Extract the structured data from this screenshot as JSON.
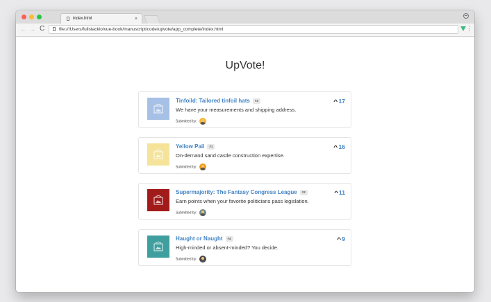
{
  "browser": {
    "tab_title": "index.html",
    "tab_close": "×",
    "url": "file:///Users/fullstackio/vue-book/manuscript/code/upvote/app_complete/index.html",
    "nav_back": "←",
    "nav_forward": "→",
    "nav_reload": "C",
    "menu": "⋮"
  },
  "app": {
    "title": "UpVote!"
  },
  "submissions": [
    {
      "title": "Tinfoild: Tailored tinfoil hats",
      "badge": "#3",
      "description": "We have your measurements and shipping address.",
      "submitted_by": "Submitted by:",
      "votes": "17",
      "thumb_color": "#a6c0e6",
      "avatar_color": "#f7b731"
    },
    {
      "title": "Yellow Pail",
      "badge": "#1",
      "description": "On-demand sand castle construction expertise.",
      "submitted_by": "Submitted by:",
      "votes": "16",
      "thumb_color": "#f5e39a",
      "avatar_color": "#f39c12"
    },
    {
      "title": "Supermajority: The Fantasy Congress League",
      "badge": "#2",
      "description": "Earn points when your favorite politicians pass legislation.",
      "submitted_by": "Submitted by:",
      "votes": "11",
      "thumb_color": "#a11b1b",
      "avatar_color": "#6f8a8a"
    },
    {
      "title": "Haught or Naught",
      "badge": "#4",
      "description": "High-minded or absent-minded? You decide.",
      "submitted_by": "Submitted by:",
      "votes": "9",
      "thumb_color": "#3f9e9e",
      "avatar_color": "#4a4a4a"
    }
  ],
  "upvote_glyph": "^",
  "colors": {
    "link": "#4183c4"
  }
}
